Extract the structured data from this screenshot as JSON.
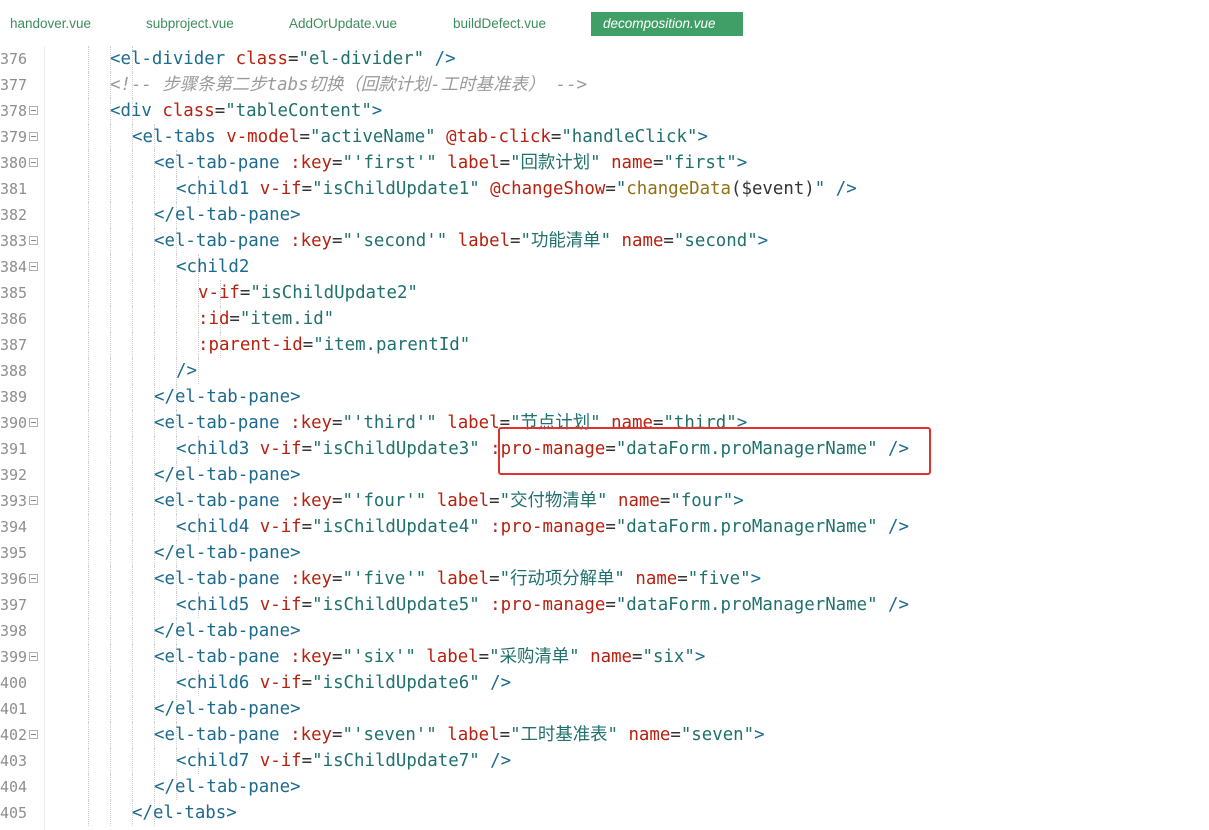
{
  "tabs": [
    {
      "label": "handover.vue",
      "active": false
    },
    {
      "label": "subproject.vue",
      "active": false
    },
    {
      "label": "AddOrUpdate.vue",
      "active": false
    },
    {
      "label": "buildDefect.vue",
      "active": false
    },
    {
      "label": "decomposition.vue",
      "active": true
    }
  ],
  "colors": {
    "tag": "#1c6b8f",
    "attribute": "#b8200f",
    "string": "#20716d",
    "function": "#937213",
    "comment": "#9a9a9a",
    "active_tab": "#3f9f66",
    "highlight_box": "#e0332f"
  },
  "code_lines": [
    {
      "num": "376",
      "fold": false,
      "indent": 4,
      "tokens": [
        [
          "t",
          "<el-divider "
        ],
        [
          "a",
          "class"
        ],
        [
          "p",
          "="
        ],
        [
          "s",
          "\"el-divider\""
        ],
        [
          "t",
          " />"
        ]
      ]
    },
    {
      "num": "377",
      "fold": false,
      "indent": 4,
      "tokens": [
        [
          "c",
          "<!-- 步骤条第二步tabs切换（回款计划-工时基准表） -->"
        ]
      ]
    },
    {
      "num": "378",
      "fold": true,
      "indent": 4,
      "tokens": [
        [
          "t",
          "<div "
        ],
        [
          "a",
          "class"
        ],
        [
          "p",
          "="
        ],
        [
          "s",
          "\"tableContent\""
        ],
        [
          "t",
          ">"
        ]
      ]
    },
    {
      "num": "379",
      "fold": true,
      "indent": 5,
      "tokens": [
        [
          "t",
          "<el-tabs "
        ],
        [
          "a",
          "v-model"
        ],
        [
          "p",
          "="
        ],
        [
          "s",
          "\"activeName\""
        ],
        [
          "p",
          " "
        ],
        [
          "a",
          "@tab-click"
        ],
        [
          "p",
          "="
        ],
        [
          "s",
          "\"handleClick\""
        ],
        [
          "t",
          ">"
        ]
      ]
    },
    {
      "num": "380",
      "fold": true,
      "indent": 6,
      "tokens": [
        [
          "t",
          "<el-tab-pane "
        ],
        [
          "a",
          ":key"
        ],
        [
          "p",
          "="
        ],
        [
          "s",
          "\"'first'\""
        ],
        [
          "p",
          " "
        ],
        [
          "a",
          "label"
        ],
        [
          "p",
          "="
        ],
        [
          "s",
          "\"回款计划\""
        ],
        [
          "p",
          " "
        ],
        [
          "a",
          "name"
        ],
        [
          "p",
          "="
        ],
        [
          "s",
          "\"first\""
        ],
        [
          "t",
          ">"
        ]
      ]
    },
    {
      "num": "381",
      "fold": false,
      "indent": 7,
      "tokens": [
        [
          "t",
          "<child1 "
        ],
        [
          "a",
          "v-if"
        ],
        [
          "p",
          "="
        ],
        [
          "s",
          "\"isChildUpdate1\""
        ],
        [
          "p",
          " "
        ],
        [
          "a",
          "@changeShow"
        ],
        [
          "p",
          "="
        ],
        [
          "s",
          "\""
        ],
        [
          "fn",
          "changeData"
        ],
        [
          "p",
          "($event)"
        ],
        [
          "s",
          "\""
        ],
        [
          "t",
          " />"
        ]
      ]
    },
    {
      "num": "382",
      "fold": false,
      "indent": 6,
      "tokens": [
        [
          "t",
          "</el-tab-pane>"
        ]
      ]
    },
    {
      "num": "383",
      "fold": true,
      "indent": 6,
      "tokens": [
        [
          "t",
          "<el-tab-pane "
        ],
        [
          "a",
          ":key"
        ],
        [
          "p",
          "="
        ],
        [
          "s",
          "\"'second'\""
        ],
        [
          "p",
          " "
        ],
        [
          "a",
          "label"
        ],
        [
          "p",
          "="
        ],
        [
          "s",
          "\"功能清单\""
        ],
        [
          "p",
          " "
        ],
        [
          "a",
          "name"
        ],
        [
          "p",
          "="
        ],
        [
          "s",
          "\"second\""
        ],
        [
          "t",
          ">"
        ]
      ]
    },
    {
      "num": "384",
      "fold": true,
      "indent": 7,
      "tokens": [
        [
          "t",
          "<child2"
        ]
      ]
    },
    {
      "num": "385",
      "fold": false,
      "indent": 8,
      "tokens": [
        [
          "a",
          "v-if"
        ],
        [
          "p",
          "="
        ],
        [
          "s",
          "\"isChildUpdate2\""
        ]
      ]
    },
    {
      "num": "386",
      "fold": false,
      "indent": 8,
      "tokens": [
        [
          "a",
          ":id"
        ],
        [
          "p",
          "="
        ],
        [
          "s",
          "\"item.id\""
        ]
      ]
    },
    {
      "num": "387",
      "fold": false,
      "indent": 8,
      "tokens": [
        [
          "a",
          ":parent-id"
        ],
        [
          "p",
          "="
        ],
        [
          "s",
          "\"item.parentId\""
        ]
      ]
    },
    {
      "num": "388",
      "fold": false,
      "indent": 7,
      "tokens": [
        [
          "t",
          "/>"
        ]
      ]
    },
    {
      "num": "389",
      "fold": false,
      "indent": 6,
      "tokens": [
        [
          "t",
          "</el-tab-pane>"
        ]
      ]
    },
    {
      "num": "390",
      "fold": true,
      "indent": 6,
      "tokens": [
        [
          "t",
          "<el-tab-pane "
        ],
        [
          "a",
          ":key"
        ],
        [
          "p",
          "="
        ],
        [
          "s",
          "\"'third'\""
        ],
        [
          "p",
          " "
        ],
        [
          "a",
          "label"
        ],
        [
          "p",
          "="
        ],
        [
          "s",
          "\"节点计划\""
        ],
        [
          "p",
          " "
        ],
        [
          "a",
          "name"
        ],
        [
          "p",
          "="
        ],
        [
          "s",
          "\"third\""
        ],
        [
          "t",
          ">"
        ]
      ]
    },
    {
      "num": "391",
      "fold": false,
      "indent": 7,
      "tokens": [
        [
          "t",
          "<child3 "
        ],
        [
          "a",
          "v-if"
        ],
        [
          "p",
          "="
        ],
        [
          "s",
          "\"isChildUpdate3\""
        ],
        [
          "p",
          " "
        ],
        [
          "a",
          ":pro-manage"
        ],
        [
          "p",
          "="
        ],
        [
          "s",
          "\"dataForm.proManagerName\""
        ],
        [
          "t",
          " />"
        ]
      ]
    },
    {
      "num": "392",
      "fold": false,
      "indent": 6,
      "tokens": [
        [
          "t",
          "</el-tab-pane>"
        ]
      ]
    },
    {
      "num": "393",
      "fold": true,
      "indent": 6,
      "tokens": [
        [
          "t",
          "<el-tab-pane "
        ],
        [
          "a",
          ":key"
        ],
        [
          "p",
          "="
        ],
        [
          "s",
          "\"'four'\""
        ],
        [
          "p",
          " "
        ],
        [
          "a",
          "label"
        ],
        [
          "p",
          "="
        ],
        [
          "s",
          "\"交付物清单\""
        ],
        [
          "p",
          " "
        ],
        [
          "a",
          "name"
        ],
        [
          "p",
          "="
        ],
        [
          "s",
          "\"four\""
        ],
        [
          "t",
          ">"
        ]
      ]
    },
    {
      "num": "394",
      "fold": false,
      "indent": 7,
      "tokens": [
        [
          "t",
          "<child4 "
        ],
        [
          "a",
          "v-if"
        ],
        [
          "p",
          "="
        ],
        [
          "s",
          "\"isChildUpdate4\""
        ],
        [
          "p",
          " "
        ],
        [
          "a",
          ":pro-manage"
        ],
        [
          "p",
          "="
        ],
        [
          "s",
          "\"dataForm.proManagerName\""
        ],
        [
          "t",
          " />"
        ]
      ]
    },
    {
      "num": "395",
      "fold": false,
      "indent": 6,
      "tokens": [
        [
          "t",
          "</el-tab-pane>"
        ]
      ]
    },
    {
      "num": "396",
      "fold": true,
      "indent": 6,
      "tokens": [
        [
          "t",
          "<el-tab-pane "
        ],
        [
          "a",
          ":key"
        ],
        [
          "p",
          "="
        ],
        [
          "s",
          "\"'five'\""
        ],
        [
          "p",
          " "
        ],
        [
          "a",
          "label"
        ],
        [
          "p",
          "="
        ],
        [
          "s",
          "\"行动项分解单\""
        ],
        [
          "p",
          " "
        ],
        [
          "a",
          "name"
        ],
        [
          "p",
          "="
        ],
        [
          "s",
          "\"five\""
        ],
        [
          "t",
          ">"
        ]
      ]
    },
    {
      "num": "397",
      "fold": false,
      "indent": 7,
      "tokens": [
        [
          "t",
          "<child5 "
        ],
        [
          "a",
          "v-if"
        ],
        [
          "p",
          "="
        ],
        [
          "s",
          "\"isChildUpdate5\""
        ],
        [
          "p",
          " "
        ],
        [
          "a",
          ":pro-manage"
        ],
        [
          "p",
          "="
        ],
        [
          "s",
          "\"dataForm.proManagerName\""
        ],
        [
          "t",
          " />"
        ]
      ]
    },
    {
      "num": "398",
      "fold": false,
      "indent": 6,
      "tokens": [
        [
          "t",
          "</el-tab-pane>"
        ]
      ]
    },
    {
      "num": "399",
      "fold": true,
      "indent": 6,
      "tokens": [
        [
          "t",
          "<el-tab-pane "
        ],
        [
          "a",
          ":key"
        ],
        [
          "p",
          "="
        ],
        [
          "s",
          "\"'six'\""
        ],
        [
          "p",
          " "
        ],
        [
          "a",
          "label"
        ],
        [
          "p",
          "="
        ],
        [
          "s",
          "\"采购清单\""
        ],
        [
          "p",
          " "
        ],
        [
          "a",
          "name"
        ],
        [
          "p",
          "="
        ],
        [
          "s",
          "\"six\""
        ],
        [
          "t",
          ">"
        ]
      ]
    },
    {
      "num": "400",
      "fold": false,
      "indent": 7,
      "tokens": [
        [
          "t",
          "<child6 "
        ],
        [
          "a",
          "v-if"
        ],
        [
          "p",
          "="
        ],
        [
          "s",
          "\"isChildUpdate6\""
        ],
        [
          "t",
          " />"
        ]
      ]
    },
    {
      "num": "401",
      "fold": false,
      "indent": 6,
      "tokens": [
        [
          "t",
          "</el-tab-pane>"
        ]
      ]
    },
    {
      "num": "402",
      "fold": true,
      "indent": 6,
      "tokens": [
        [
          "t",
          "<el-tab-pane "
        ],
        [
          "a",
          ":key"
        ],
        [
          "p",
          "="
        ],
        [
          "s",
          "\"'seven'\""
        ],
        [
          "p",
          " "
        ],
        [
          "a",
          "label"
        ],
        [
          "p",
          "="
        ],
        [
          "s",
          "\"工时基准表\""
        ],
        [
          "p",
          " "
        ],
        [
          "a",
          "name"
        ],
        [
          "p",
          "="
        ],
        [
          "s",
          "\"seven\""
        ],
        [
          "t",
          ">"
        ]
      ]
    },
    {
      "num": "403",
      "fold": false,
      "indent": 7,
      "tokens": [
        [
          "t",
          "<child7 "
        ],
        [
          "a",
          "v-if"
        ],
        [
          "p",
          "="
        ],
        [
          "s",
          "\"isChildUpdate7\""
        ],
        [
          "t",
          " />"
        ]
      ]
    },
    {
      "num": "404",
      "fold": false,
      "indent": 6,
      "tokens": [
        [
          "t",
          "</el-tab-pane>"
        ]
      ]
    },
    {
      "num": "405",
      "fold": false,
      "indent": 5,
      "tokens": [
        [
          "t",
          "</el-tabs>"
        ]
      ]
    }
  ]
}
